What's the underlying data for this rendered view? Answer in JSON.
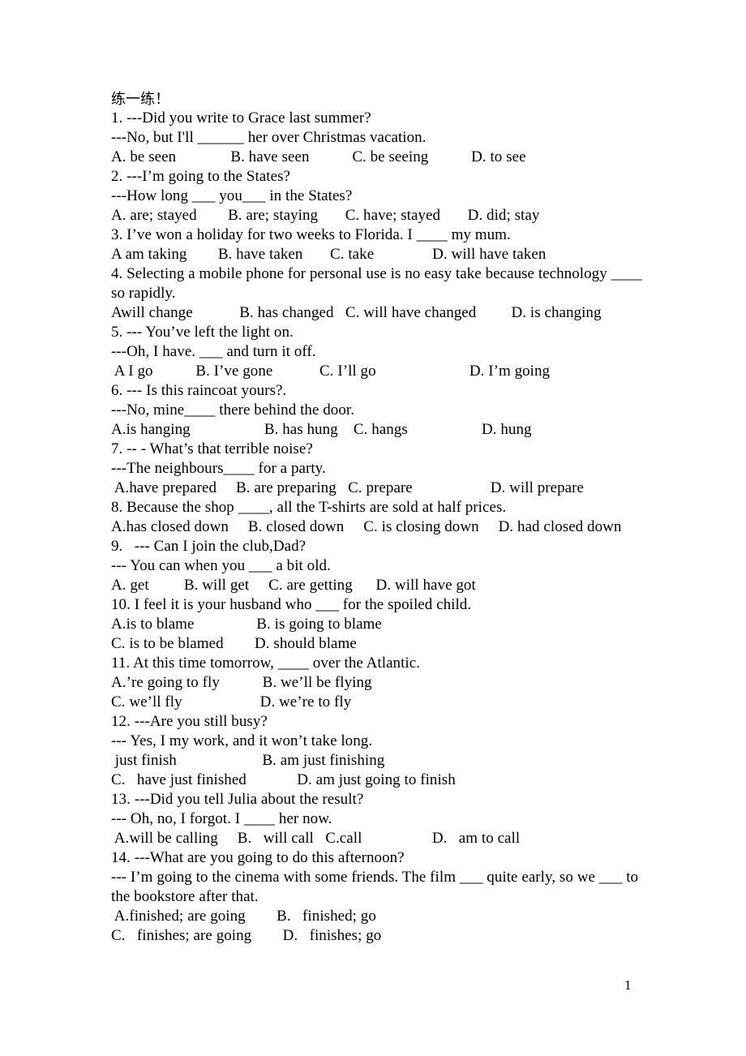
{
  "document": {
    "title_cjk": "练一练！",
    "page_number": "1",
    "lines": [
      {
        "id": "title",
        "text": "练一练！",
        "kind": "heading-cjk"
      },
      {
        "id": "q1-stem-a",
        "text": "1. ---Did you write to Grace last summer?",
        "kind": "stem"
      },
      {
        "id": "q1-stem-b",
        "text": "---No, but I'll ______ her over Christmas vacation.",
        "kind": "stem"
      },
      {
        "id": "q1-options",
        "text": "A. be seen              B. have seen           C. be seeing           D. to see",
        "kind": "options"
      },
      {
        "id": "q2-stem-a",
        "text": "2. ---I’m going to the States?",
        "kind": "stem"
      },
      {
        "id": "q2-stem-b",
        "text": "---How long ___ you___ in the States?",
        "kind": "stem"
      },
      {
        "id": "q2-options",
        "text": "A. are; stayed        B. are; staying       C. have; stayed       D. did; stay",
        "kind": "options"
      },
      {
        "id": "q3-stem",
        "text": "3. I’ve won a holiday for two weeks to Florida. I ____ my mum.",
        "kind": "stem"
      },
      {
        "id": "q3-options",
        "text": "A am taking        B. have taken       C. take               D. will have taken",
        "kind": "options"
      },
      {
        "id": "q4-stem-a",
        "text": "4. Selecting a mobile phone for personal use is no easy take because technology ____",
        "kind": "stem"
      },
      {
        "id": "q4-stem-b",
        "text": "so rapidly.",
        "kind": "stem"
      },
      {
        "id": "q4-options",
        "text": "Awill change            B. has changed   C. will have changed         D. is changing",
        "kind": "options"
      },
      {
        "id": "q5-stem-a",
        "text": "5. --- You’ve left the light on.",
        "kind": "stem"
      },
      {
        "id": "q5-stem-b",
        "text": "---Oh, I have. ___ and turn it off.",
        "kind": "stem"
      },
      {
        "id": "q5-options",
        "text": " A I go           B. I’ve gone            C. I’ll go                        D. I’m going",
        "kind": "options"
      },
      {
        "id": "q6-stem-a",
        "text": "6. --- Is this raincoat yours?.",
        "kind": "stem"
      },
      {
        "id": "q6-stem-b",
        "text": "---No, mine____ there behind the door.",
        "kind": "stem"
      },
      {
        "id": "q6-options",
        "text": "A.is hanging                   B. has hung    C. hangs                   D. hung",
        "kind": "options"
      },
      {
        "id": "q7-stem-a",
        "text": "7. -- - What’s that terrible noise?",
        "kind": "stem"
      },
      {
        "id": "q7-stem-b",
        "text": "---The neighbours____ for a party.",
        "kind": "stem"
      },
      {
        "id": "q7-options",
        "text": " A.have prepared     B. are preparing   C. prepare                    D. will prepare",
        "kind": "options"
      },
      {
        "id": "q8-stem",
        "text": "8. Because the shop ____, all the T-shirts are sold at half prices.",
        "kind": "stem"
      },
      {
        "id": "q8-options",
        "text": "A.has closed down     B. closed down     C. is closing down     D. had closed down",
        "kind": "options"
      },
      {
        "id": "q9-stem-a",
        "text": "9.   --- Can I join the club,Dad?",
        "kind": "stem"
      },
      {
        "id": "q9-stem-b",
        "text": "--- You can when you ___ a bit old.",
        "kind": "stem"
      },
      {
        "id": "q9-options",
        "text": "A. get         B. will get     C. are getting      D. will have got",
        "kind": "options"
      },
      {
        "id": "q10-stem",
        "text": "10. I feel it is your husband who ___ for the spoiled child.",
        "kind": "stem"
      },
      {
        "id": "q10-options-1",
        "text": "A.is to blame                B. is going to blame",
        "kind": "options"
      },
      {
        "id": "q10-options-2",
        "text": "C. is to be blamed        D. should blame",
        "kind": "options"
      },
      {
        "id": "q11-stem",
        "text": "11. At this time tomorrow, ____ over the Atlantic.",
        "kind": "stem"
      },
      {
        "id": "q11-options-1",
        "text": "A.’re going to fly           B. we’ll be flying",
        "kind": "options"
      },
      {
        "id": "q11-options-2",
        "text": "C. we’ll fly                    D. we’re to fly",
        "kind": "options"
      },
      {
        "id": "q12-stem-a",
        "text": "12. ---Are you still busy?",
        "kind": "stem"
      },
      {
        "id": "q12-stem-b",
        "text": "--- Yes, I my work, and it won’t take long.",
        "kind": "stem"
      },
      {
        "id": "q12-options-1",
        "text": " just finish                      B. am just finishing",
        "kind": "options"
      },
      {
        "id": "q12-options-2",
        "text": "C.   have just finished             D. am just going to finish",
        "kind": "options"
      },
      {
        "id": "q13-stem-a",
        "text": "13. ---Did you tell Julia about the result?",
        "kind": "stem"
      },
      {
        "id": "q13-stem-b",
        "text": "--- Oh, no, I forgot. I ____ her now.",
        "kind": "stem"
      },
      {
        "id": "q13-options",
        "text": " A.will be calling     B.   will call   C.call                  D.   am to call",
        "kind": "options"
      },
      {
        "id": "q14-stem-a",
        "text": "14. ---What are you going to do this afternoon?",
        "kind": "stem"
      },
      {
        "id": "q14-stem-b",
        "text": "--- I’m going to the cinema with some friends. The film ___ quite early, so we ___ to",
        "kind": "stem"
      },
      {
        "id": "q14-stem-c",
        "text": "the bookstore after that.",
        "kind": "stem"
      },
      {
        "id": "q14-options-1",
        "text": " A.finished; are going        B.   finished; go",
        "kind": "options"
      },
      {
        "id": "q14-options-2",
        "text": "C.   finishes; are going        D.   finishes; go",
        "kind": "options"
      }
    ]
  }
}
